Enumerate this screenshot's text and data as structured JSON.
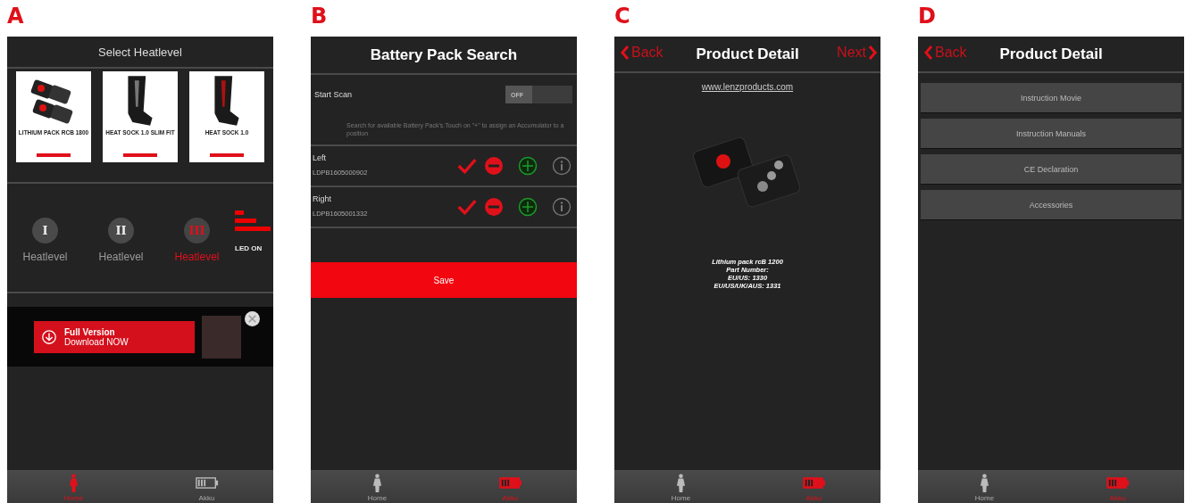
{
  "panels": [
    {
      "letter": "A",
      "kind": "heatlevel",
      "title": "Select Heatlevel",
      "products": [
        {
          "name": "LITHIUM PACK RCB 1800"
        },
        {
          "name": "HEAT SOCK 1.0 SLIM FIT"
        },
        {
          "name": "HEAT SOCK 1.0"
        }
      ],
      "levels": [
        {
          "numeral": "I",
          "label": "Heatlevel",
          "selected": false
        },
        {
          "numeral": "II",
          "label": "Heatlevel",
          "selected": false
        },
        {
          "numeral": "III",
          "label": "Heatlevel",
          "selected": true
        }
      ],
      "led": {
        "label": "LED ON",
        "on": true
      },
      "promo": {
        "title": "Full Version",
        "subtitle": "Download NOW"
      },
      "nav": [
        {
          "label": "Home",
          "selected": true
        },
        {
          "label": "Akku",
          "selected": false
        }
      ]
    },
    {
      "letter": "B",
      "kind": "search",
      "title": "Battery Pack Search",
      "scan": {
        "label": "Start Scan",
        "toggle": "OFF",
        "on": false
      },
      "hint": "Search for available Battery Pack's.Touch on \"+\" to assign an Accumulator to a position",
      "positions": [
        {
          "label": "Left",
          "serial": "LDPB1605000902"
        },
        {
          "label": "Right",
          "serial": "LDPB1605001332"
        }
      ],
      "save": "Save",
      "nav": [
        {
          "label": "Home",
          "selected": false
        },
        {
          "label": "Akku",
          "selected": true
        }
      ]
    },
    {
      "letter": "C",
      "kind": "detail",
      "back": "Back",
      "title": "Product Detail",
      "next": "Next",
      "link": "www.lenzproducts.com",
      "details": [
        "Lithium pack rcB 1200",
        "Part Number:",
        "EU/US: 1330",
        "EU/US/UK/AUS: 1331"
      ],
      "nav": [
        {
          "label": "Home",
          "selected": false
        },
        {
          "label": "Akku",
          "selected": true
        }
      ]
    },
    {
      "letter": "D",
      "kind": "menu",
      "back": "Back",
      "title": "Product Detail",
      "items": [
        "Instruction Movie",
        "Instruction Manuals",
        "CE Declaration",
        "Accessories"
      ],
      "nav": [
        {
          "label": "Home",
          "selected": false
        },
        {
          "label": "Akku",
          "selected": true
        }
      ]
    }
  ]
}
